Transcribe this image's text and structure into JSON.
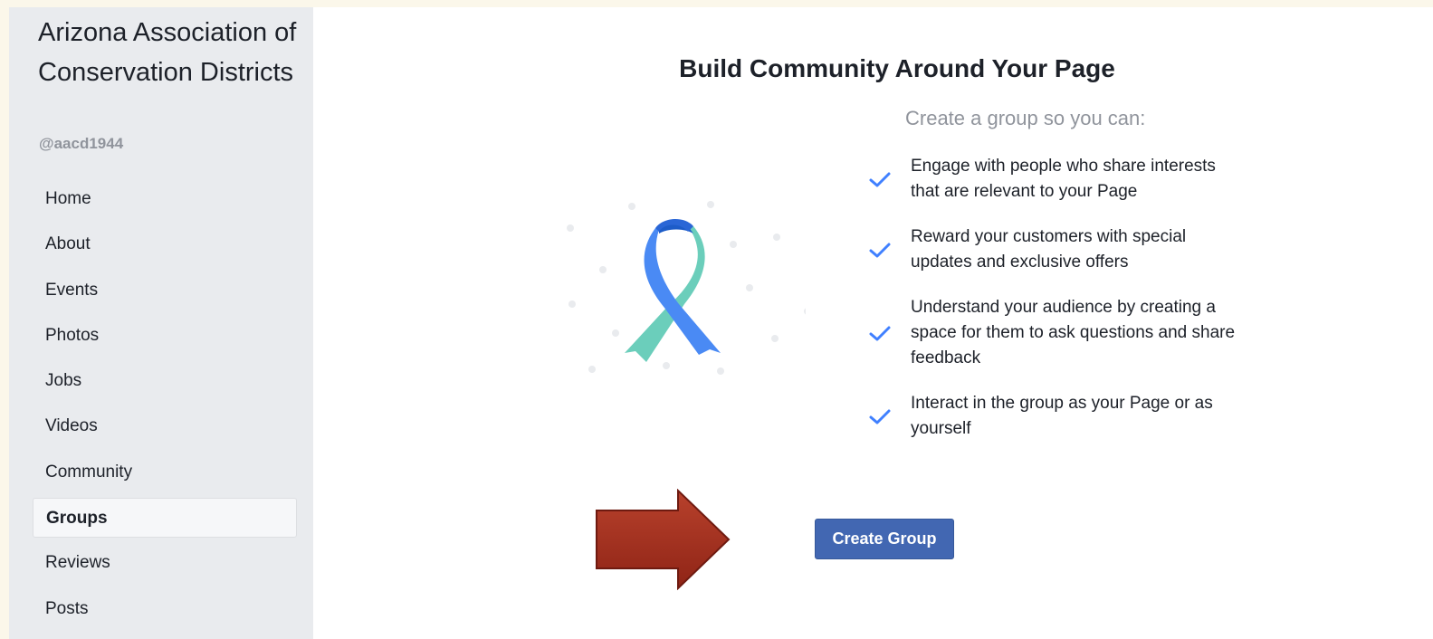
{
  "sidebar": {
    "page_name": "Arizona Association of Conservation Districts",
    "handle": "@aacd1944",
    "items": [
      {
        "label": "Home"
      },
      {
        "label": "About"
      },
      {
        "label": "Events"
      },
      {
        "label": "Photos"
      },
      {
        "label": "Jobs"
      },
      {
        "label": "Videos"
      },
      {
        "label": "Community"
      },
      {
        "label": "Groups",
        "active": true
      },
      {
        "label": "Reviews"
      },
      {
        "label": "Posts"
      }
    ]
  },
  "main": {
    "title": "Build Community Around Your Page",
    "subtitle": "Create a group so you can:",
    "benefits": [
      "Engage with people who share interests that are relevant to your Page",
      "Reward your customers with special updates and exclusive offers",
      "Understand your audience by creating a space for them to ask questions and share feedback",
      "Interact in the group as your Page or as yourself"
    ],
    "create_button_label": "Create Group"
  },
  "icons": {
    "check": "check-icon",
    "ribbon": "ribbon-icon",
    "arrow": "arrow-right-icon"
  },
  "colors": {
    "accent": "#4267b2",
    "check": "#4080ff",
    "arrow": "#a5301f",
    "sidebar_bg": "#e9ebee"
  }
}
